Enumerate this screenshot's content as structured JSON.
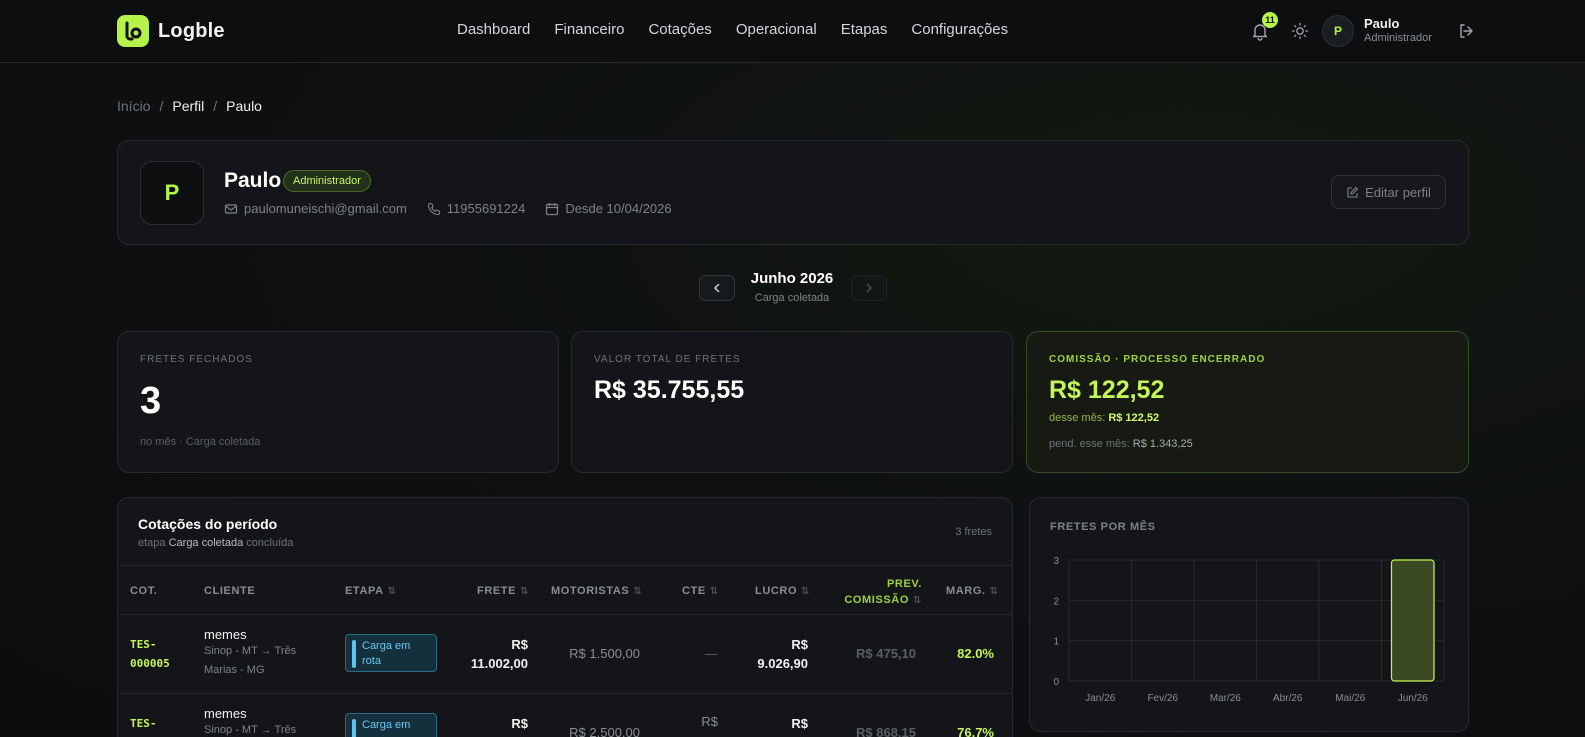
{
  "app": {
    "name": "Logble"
  },
  "nav": [
    "Dashboard",
    "Financeiro",
    "Cotações",
    "Operacional",
    "Etapas",
    "Configurações"
  ],
  "topbar": {
    "notification_count": "11",
    "user_initial": "P",
    "user_name": "Paulo",
    "user_role": "Administrador"
  },
  "breadcrumb": [
    "Início",
    "/",
    "Perfil",
    "/",
    "Paulo"
  ],
  "profile": {
    "initial": "P",
    "name": "Paulo",
    "badge": "Administrador",
    "email": "paulomuneischi@gmail.com",
    "phone": "11955691224",
    "since": "Desde 10/04/2026",
    "edit_label": "Editar perfil"
  },
  "period": {
    "title": "Junho 2026",
    "subtitle": "Carga coletada"
  },
  "stats": {
    "fretes": {
      "label": "FRETES FECHADOS",
      "value": "3",
      "foot": "no mês · Carga coletada"
    },
    "valor": {
      "label": "VALOR TOTAL DE FRETES",
      "value": "R$ 35.755,55"
    },
    "comissao": {
      "label": "COMISSÃO · PROCESSO ENCERRADO",
      "value": "R$ 122,52",
      "mes_label": "desse mês:",
      "mes_value": "R$ 122,52",
      "pend_label": "pend. esse mês:",
      "pend_value": "R$ 1.343,25"
    }
  },
  "table": {
    "title": "Cotações do período",
    "sub_prefix": "etapa",
    "sub_stage": "Carga coletada",
    "sub_suffix": "concluída",
    "count": "3 fretes",
    "columns": {
      "cot": "COT.",
      "cliente": "CLIENTE",
      "etapa": "ETAPA",
      "frete": "FRETE",
      "motoristas": "MOTORISTAS",
      "cte": "CTE",
      "lucro": "LUCRO",
      "prev1": "PREV.",
      "prev2": "COMISSÃO",
      "marg": "MARG."
    },
    "sort_glyph": "⇅",
    "rows": [
      {
        "cot1": "TES-",
        "cot2": "000005",
        "cliente": "memes",
        "route1": "Sinop - MT → Três",
        "route2": "Marias - MG",
        "etapa1": "Carga em",
        "etapa2": "rota",
        "frete1": "R$",
        "frete2": "11.002,00",
        "motoristas": "R$ 1.500,00",
        "cte": "—",
        "lucro1": "R$",
        "lucro2": "9.026,90",
        "comissao": "R$ 475,10",
        "marg": "82.0%"
      },
      {
        "cot1": "TES-",
        "cot2": "",
        "cliente": "memes",
        "route1": "Sinop - MT → Três",
        "route2": "",
        "etapa1": "Carga em",
        "etapa2": "",
        "frete1": "R$",
        "frete2": "",
        "motoristas": "R$ 2.500,00",
        "cte": "R$",
        "lucro1": "R$",
        "lucro2": "",
        "comissao": "R$ 868,15",
        "marg": "76.7%"
      }
    ]
  },
  "chart_data": {
    "type": "bar",
    "title": "FRETES POR MÊS",
    "categories": [
      "Jan/26",
      "Fev/26",
      "Mar/26",
      "Abr/26",
      "Mai/26",
      "Jun/26"
    ],
    "values": [
      0,
      0,
      0,
      0,
      0,
      3
    ],
    "ylim": [
      0,
      3
    ],
    "yticks": [
      "0",
      "1",
      "2",
      "3"
    ],
    "grid": true,
    "bar_color": "#3b4a22",
    "bar_border": "#c6f55a"
  },
  "colors": {
    "accent": "#b6f34a",
    "background": "#0e1012"
  }
}
